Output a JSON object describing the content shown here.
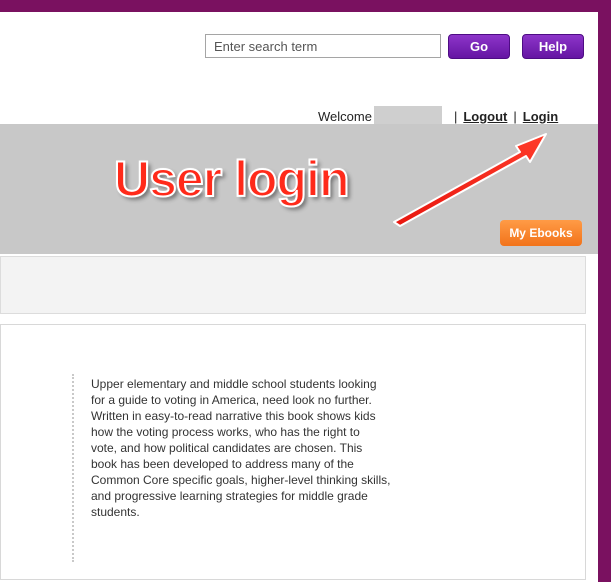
{
  "search": {
    "placeholder": "Enter search term"
  },
  "header": {
    "go_label": "Go",
    "help_label": "Help"
  },
  "user_bar": {
    "welcome": "Welcome",
    "separator": "|",
    "logout": "Logout",
    "login": "Login"
  },
  "annotation": {
    "text": "User login",
    "color": "#ff2a1a"
  },
  "ebooks": {
    "label": "My Ebooks"
  },
  "book": {
    "description_lines": [
      "Upper elementary and middle school students looking",
      "for a guide to voting in America, need look no further.",
      "Written in easy-to-read narrative this book shows kids",
      "how the voting process works, who has the right to",
      "vote, and how political candidates are chosen. This",
      "book has been developed to address many of the",
      "Common Core specific goals, higher-level thinking skills,",
      "and progressive learning strategies for middle grade",
      "students."
    ]
  },
  "colors": {
    "frame": "#7a1160",
    "button_purple": "#7322b5",
    "button_orange": "#f5801f",
    "band_gray": "#c8c8c8"
  }
}
